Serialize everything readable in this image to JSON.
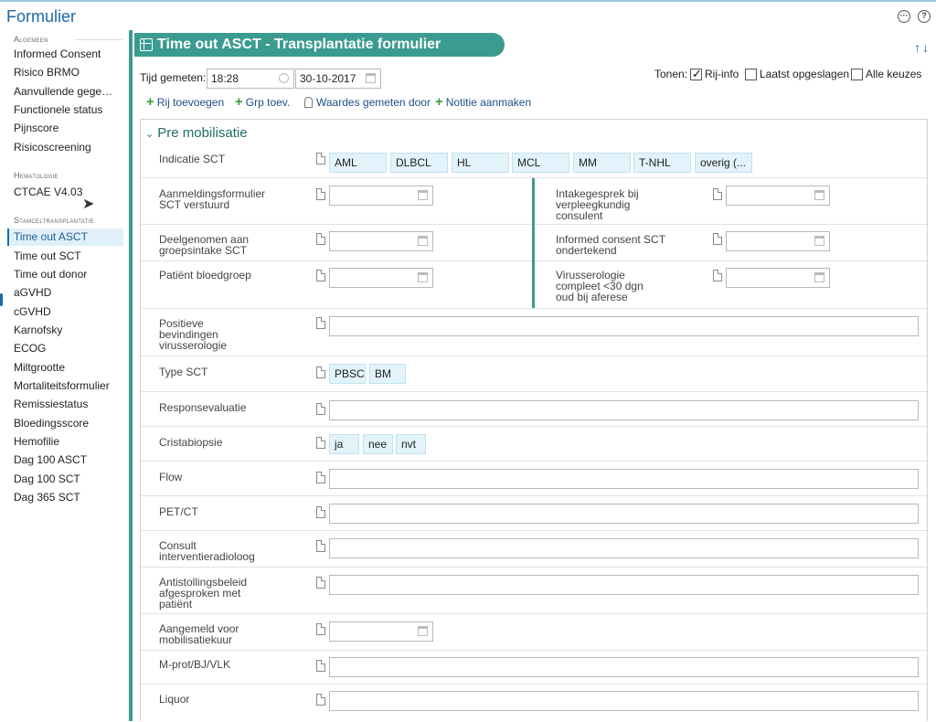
{
  "app": {
    "title": "Formulier"
  },
  "header_icons": [
    "more-icon",
    "help-icon"
  ],
  "sidebar": {
    "sections": [
      {
        "title": "Algemeen",
        "items": [
          "Informed Consent",
          "Risico BRMO",
          "Aanvullende gege…",
          "Functionele status",
          "Pijnscore",
          "Risicoscreening"
        ]
      },
      {
        "title": "Hematologie",
        "items": [
          "CTCAE V4.03"
        ]
      },
      {
        "title": "Stamceltransplantatie",
        "items": [
          "Time out ASCT",
          "Time out SCT",
          "Time out donor",
          "aGVHD",
          "cGVHD",
          "Karnofsky",
          "ECOG",
          "Miltgrootte",
          "Mortaliteitsformulier",
          "Remissiestatus",
          "Bloedingsscore",
          "Hemofilie",
          "Dag 100 ASCT",
          "Dag 100 SCT",
          "Dag 365 SCT"
        ]
      }
    ],
    "active_item": "Time out ASCT"
  },
  "form": {
    "title": "Time out ASCT - Transplantatie formulier Autoloog",
    "tijd_label": "Tijd gemeten:",
    "time_value": "18:28",
    "date_value": "30-10-2017",
    "tonen_label": "Tonen:",
    "options": [
      {
        "label": "Rij-info",
        "checked": true
      },
      {
        "label": "Laatst opgeslagen",
        "checked": false
      },
      {
        "label": "Alle keuzes",
        "checked": false
      }
    ],
    "toolbar": {
      "rij_toevoegen": "Rij toevoegen",
      "grp_toev": "Grp toev.",
      "waardes_gemeten_door": "Waardes gemeten door",
      "notitie_aanmaken": "Notitie aanmaken"
    },
    "section_title": "Pre mobilisatie",
    "rows": {
      "indicatie_sct": {
        "label": "Indicatie SCT",
        "choices": [
          "AML",
          "DLBCL",
          "HL",
          "MCL",
          "MM",
          "T-NHL",
          "overig (..."
        ]
      },
      "aanmeldingsformulier": {
        "label": "Aanmeldingsformulier SCT verstuurd"
      },
      "intakegesprek": {
        "label": "Intakegesprek bij verpleegkundig consulent"
      },
      "deelgenomen": {
        "label": "Deelgenomen aan groepsintake SCT"
      },
      "informed_consent": {
        "label": "Informed consent SCT ondertekend"
      },
      "bloedgroep": {
        "label": "Patiënt bloedgroep"
      },
      "virusserologie": {
        "label": "Virusserologie compleet <30 dgn oud bij aferese"
      },
      "positieve_bevindingen": {
        "label": "Positieve bevindingen virusserologie"
      },
      "type_sct": {
        "label": "Type SCT",
        "choices": [
          "PBSC",
          "BM"
        ]
      },
      "responsevaluatie": {
        "label": "Responsevaluatie"
      },
      "cristabiopsie": {
        "label": "Cristabiopsie",
        "choices": [
          "ja",
          "nee",
          "nvt"
        ]
      },
      "flow": {
        "label": "Flow"
      },
      "pet_ct": {
        "label": "PET/CT"
      },
      "consult": {
        "label": "Consult interventieradioloog"
      },
      "antistolling": {
        "label": "Antistollingsbeleid afgesproken met patiënt"
      },
      "aangemeld": {
        "label": "Aangemeld voor mobilisatiekuur"
      },
      "m_prot": {
        "label": "M-prot/BJ/VLK"
      },
      "liquor": {
        "label": "Liquor"
      }
    }
  }
}
